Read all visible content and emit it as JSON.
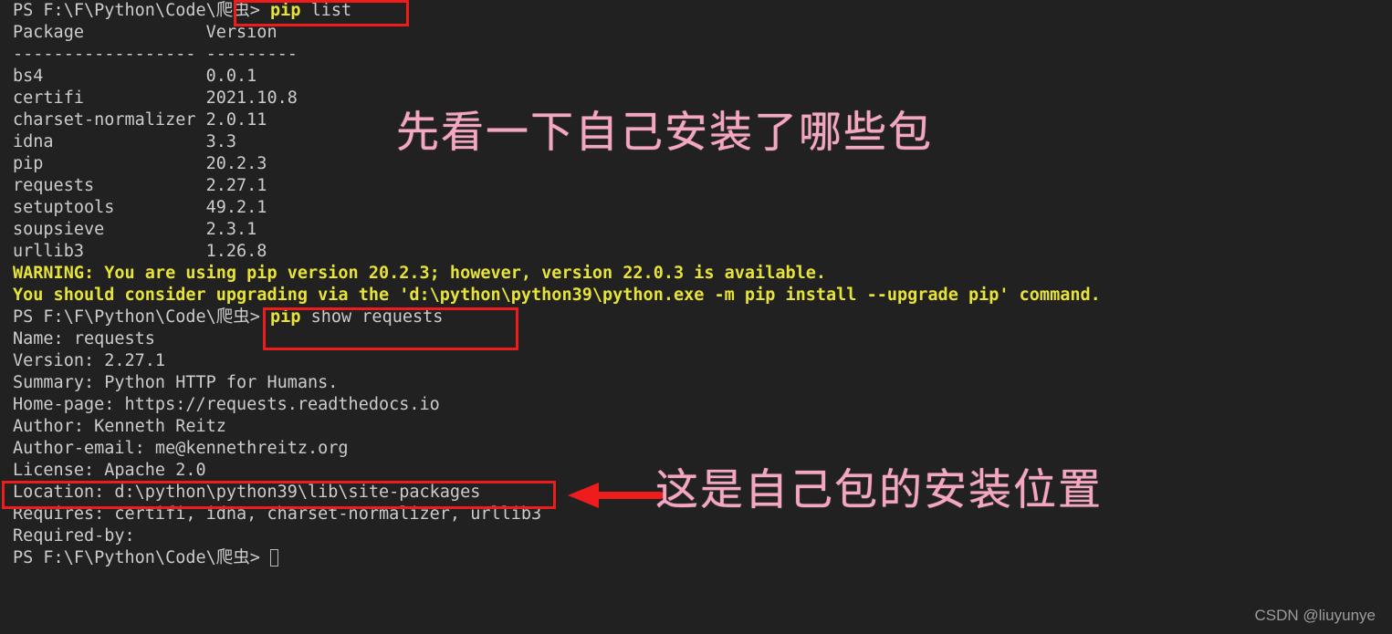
{
  "terminal": {
    "background_color": "#212121",
    "text_color": "#cccccc",
    "command_color": "#e8e337",
    "warning_color": "#e8e337",
    "lines": [
      {
        "prompt": "PS F:\\F\\Python\\Code\\爬虫> ",
        "command": "pip",
        "rest": " list"
      },
      {
        "text": "Package            Version"
      },
      {
        "text": "------------------ ---------"
      },
      {
        "text": "bs4                0.0.1"
      },
      {
        "text": "certifi            2021.10.8"
      },
      {
        "text": "charset-normalizer 2.0.11"
      },
      {
        "text": "idna               3.3"
      },
      {
        "text": "pip                20.2.3"
      },
      {
        "text": "requests           2.27.1"
      },
      {
        "text": "setuptools         49.2.1"
      },
      {
        "text": "soupsieve          2.3.1"
      },
      {
        "text": "urllib3            1.26.8"
      },
      {
        "warning": "WARNING: You are using pip version 20.2.3; however, version 22.0.3 is available."
      },
      {
        "warning": "You should consider upgrading via the 'd:\\python\\python39\\python.exe -m pip install --upgrade pip' command."
      },
      {
        "prompt": "PS F:\\F\\Python\\Code\\爬虫> ",
        "command": "pip",
        "rest": " show requests"
      },
      {
        "text": "Name: requests"
      },
      {
        "text": "Version: 2.27.1"
      },
      {
        "text": "Summary: Python HTTP for Humans."
      },
      {
        "text": "Home-page: https://requests.readthedocs.io"
      },
      {
        "text": "Author: Kenneth Reitz"
      },
      {
        "text": "Author-email: me@kennethreitz.org"
      },
      {
        "text": "License: Apache 2.0"
      },
      {
        "text": "Location: d:\\python\\python39\\lib\\site-packages"
      },
      {
        "text": "Requires: certifi, idna, charset-normalizer, urllib3"
      },
      {
        "text": "Required-by:"
      },
      {
        "prompt": "PS F:\\F\\Python\\Code\\爬虫> ",
        "command": "",
        "rest": "",
        "cursor": true
      }
    ]
  },
  "annotations": {
    "color": "#f4a8c0",
    "box_color": "#ee1c1c",
    "top_note": "先看一下自己安装了哪些包",
    "bottom_note": "这是自己包的安装位置",
    "highlight_pip_list": "pip list",
    "highlight_pip_show": "pip show requests",
    "highlight_location": "Location: d:\\python\\python39\\lib\\site-packages"
  },
  "watermark": {
    "text": "CSDN @liuyunye"
  }
}
